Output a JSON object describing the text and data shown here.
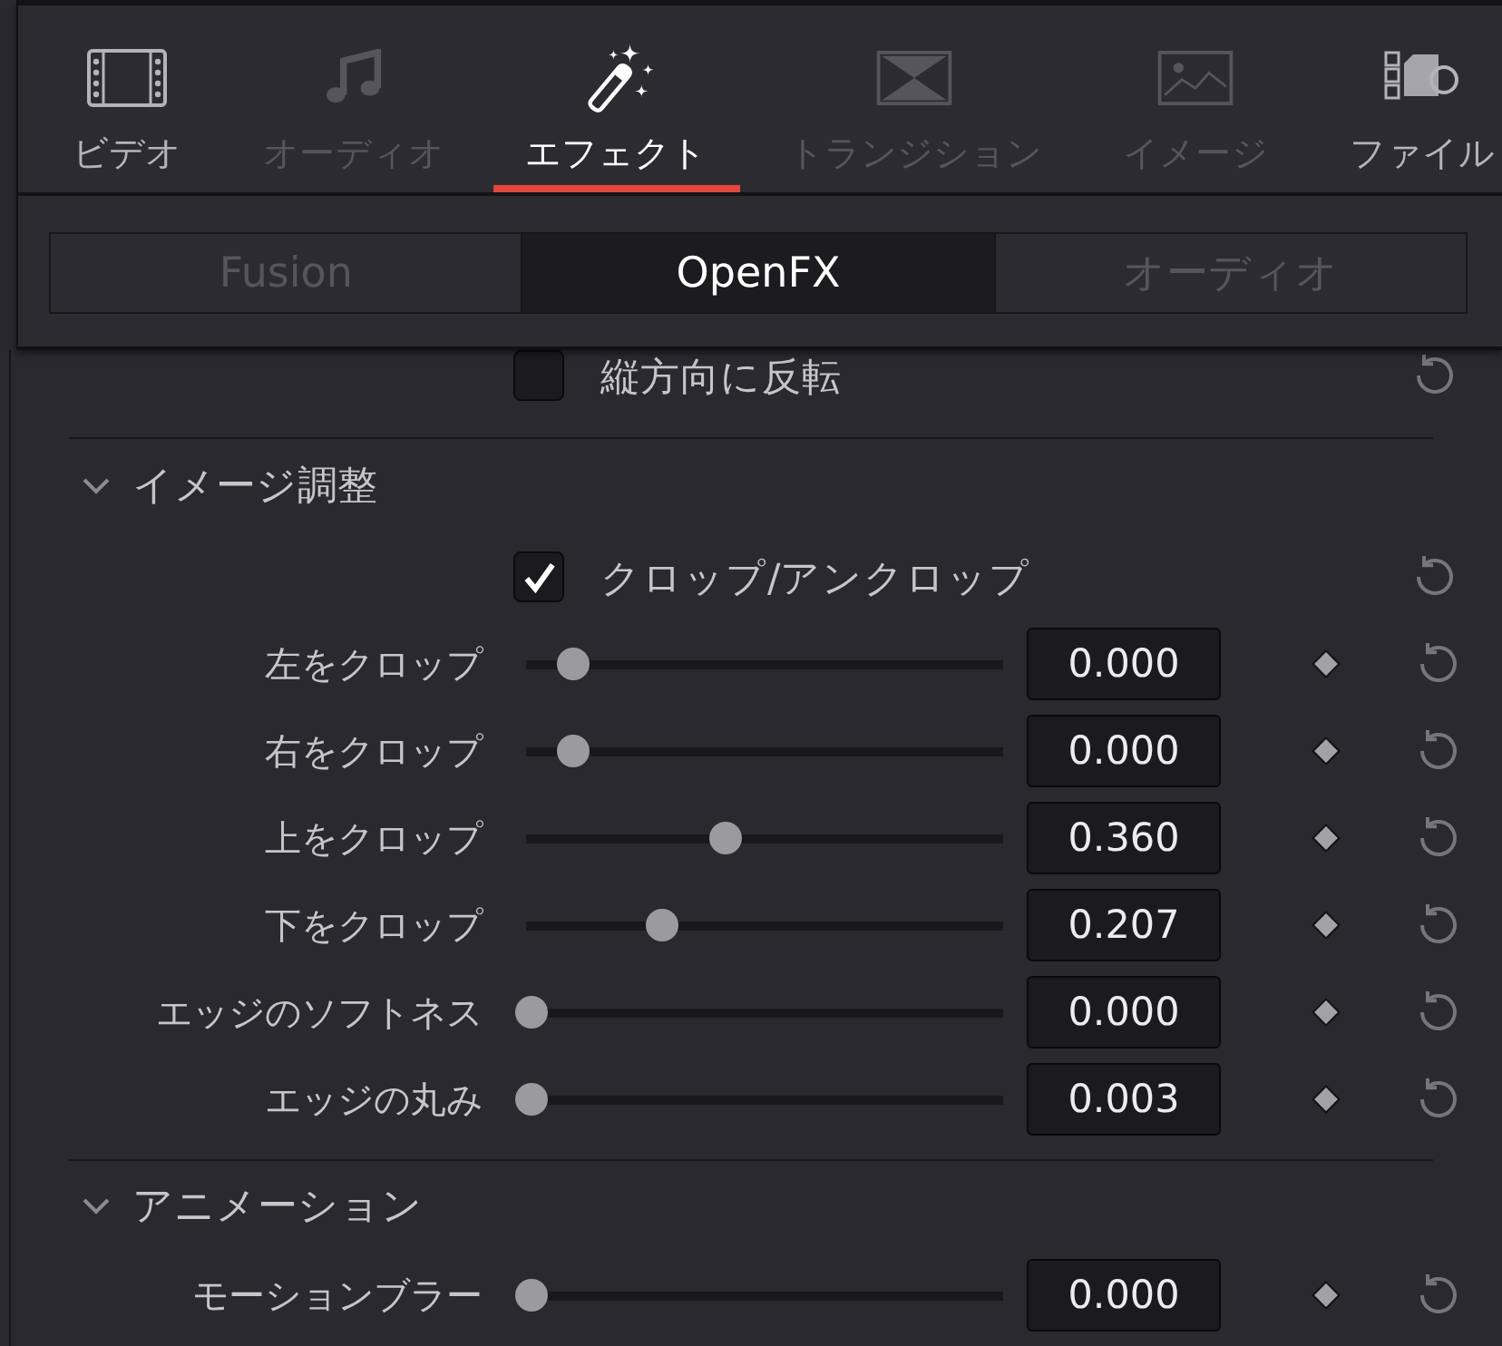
{
  "media_tabs": [
    {
      "label": "ビデオ",
      "selected": false,
      "disabled": false
    },
    {
      "label": "オーディオ",
      "selected": false,
      "disabled": true
    },
    {
      "label": "エフェクト",
      "selected": true,
      "disabled": false
    },
    {
      "label": "トランジション",
      "selected": false,
      "disabled": true
    },
    {
      "label": "イメージ",
      "selected": false,
      "disabled": true
    },
    {
      "label": "ファイル",
      "selected": false,
      "disabled": false
    }
  ],
  "effect_types": [
    {
      "label": "Fusion",
      "selected": false
    },
    {
      "label": "OpenFX",
      "selected": true
    },
    {
      "label": "オーディオ",
      "selected": false
    }
  ],
  "previous_section_rows": [
    {
      "kind": "checkbox",
      "label": "縦方向に反転",
      "checked": false
    }
  ],
  "sections": [
    {
      "title": "イメージ調整",
      "expanded": true,
      "rows": [
        {
          "kind": "checkbox",
          "label": "クロップ/アンクロップ",
          "checked": true
        },
        {
          "kind": "slider",
          "label": "左をクロップ",
          "level": 0.1,
          "value": "0.000"
        },
        {
          "kind": "slider",
          "label": "右をクロップ",
          "level": 0.1,
          "value": "0.000"
        },
        {
          "kind": "slider",
          "label": "上をクロップ",
          "level": 0.42,
          "value": "0.360"
        },
        {
          "kind": "slider",
          "label": "下をクロップ",
          "level": 0.285,
          "value": "0.207"
        },
        {
          "kind": "slider",
          "label": "エッジのソフトネス",
          "level": 0.01,
          "value": "0.000"
        },
        {
          "kind": "slider",
          "label": "エッジの丸み",
          "level": 0.01,
          "value": "0.003"
        }
      ]
    },
    {
      "title": "アニメーション",
      "expanded": true,
      "rows": [
        {
          "kind": "slider",
          "label": "モーションブラー",
          "level": 0.01,
          "value": "0.000"
        }
      ]
    }
  ]
}
